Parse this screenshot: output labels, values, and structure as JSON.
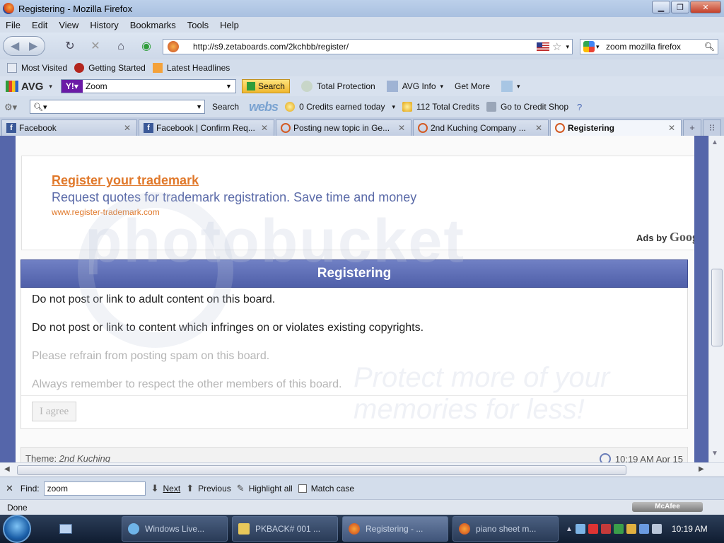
{
  "window": {
    "title": "Registering - Mozilla Firefox"
  },
  "menu": [
    "File",
    "Edit",
    "View",
    "History",
    "Bookmarks",
    "Tools",
    "Help"
  ],
  "nav": {
    "url": "http://s9.zetaboards.com/2kchbb/register/",
    "search_value": "zoom mozilla firefox"
  },
  "bookmarks": [
    "Most Visited",
    "Getting Started",
    "Latest Headlines"
  ],
  "avg_toolbar": {
    "brand": "AVG",
    "search_value": "Zoom",
    "search_label": "Search",
    "total_protection": "Total Protection",
    "avg_info": "AVG Info",
    "get_more": "Get More"
  },
  "webs_toolbar": {
    "search_label": "Search",
    "logo": "webs",
    "credits_today": "0 Credits earned today",
    "total_credits": "112 Total Credits",
    "credit_shop": "Go to Credit Shop"
  },
  "tabs": [
    {
      "label": "Facebook",
      "type": "fb"
    },
    {
      "label": "Facebook | Confirm Req...",
      "type": "fb"
    },
    {
      "label": "Posting new topic in Ge...",
      "type": "zeta"
    },
    {
      "label": "2nd Kuching Company ...",
      "type": "zeta"
    },
    {
      "label": "Registering",
      "type": "zeta",
      "active": true
    }
  ],
  "ad": {
    "title": "Register your trademark",
    "description": "Request quotes for trademark registration. Save time and money",
    "url": "www.register-trademark.com",
    "ads_by": "Ads by",
    "google": "Googl"
  },
  "panel": {
    "header": "Registering",
    "rules": [
      "Do not post or link to adult content on this board.",
      "Do not post or link to content which infringes on or violates existing copyrights.",
      "Please refrain from posting spam on this board.",
      "Always remember to respect the other members of this board."
    ],
    "agree_label": "I agree"
  },
  "footer": {
    "theme_label": "Theme:",
    "theme_name": "2nd Kuching",
    "time": "10:19 AM Apr 15"
  },
  "watermark": {
    "brand": "photobucket",
    "tagline": "Protect more of your memories for less!"
  },
  "findbar": {
    "label": "Find:",
    "value": "zoom",
    "next": "Next",
    "previous": "Previous",
    "highlight_all": "Highlight all",
    "match_case": "Match case"
  },
  "status": {
    "text": "Done",
    "mcafee": "McAfee"
  },
  "taskbar": {
    "tasks": [
      "Windows Live...",
      "PKBACK# 001 ...",
      "Registering - ...",
      "piano sheet m..."
    ],
    "time": "10:19 AM"
  }
}
